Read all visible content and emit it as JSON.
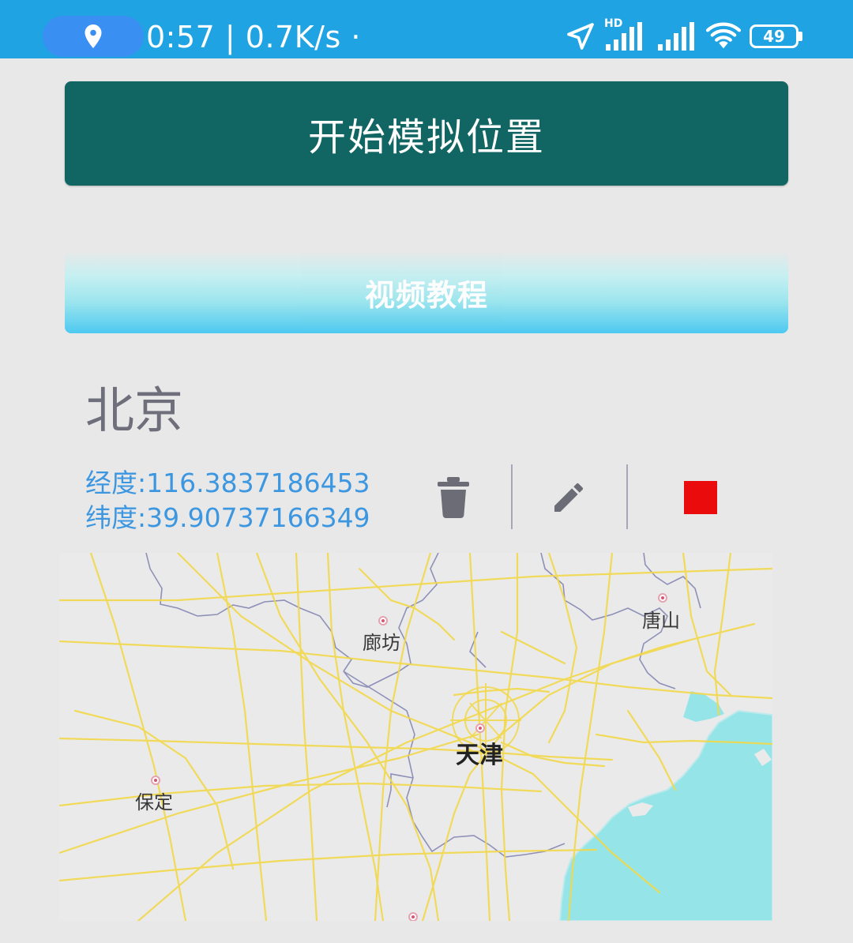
{
  "status_bar": {
    "time_speed": "0:57 | 0.7K/s ·",
    "battery_level": "49",
    "hd_label": "HD",
    "icons": [
      "location-pin-icon",
      "navigation-arrow-icon",
      "signal-icon",
      "signal-icon",
      "wifi-icon",
      "battery-icon"
    ],
    "background": "#1fa3e3"
  },
  "buttons": {
    "start_label": "开始模拟位置",
    "video_label": "视频教程"
  },
  "location": {
    "city": "北京",
    "longitude_label": "经度:",
    "longitude_value": "116.3837186453",
    "latitude_label": "纬度:",
    "latitude_value": "39.90737166349"
  },
  "actions": {
    "icons": [
      "trash-icon",
      "pencil-icon",
      "stop-icon"
    ],
    "stop_color": "#ea0c0c"
  },
  "map": {
    "labels": {
      "langfang": "廊坊",
      "tangshan": "唐山",
      "tianjin": "天津",
      "baoding": "保定"
    },
    "sea_color": "#95e5e8",
    "road_color": "#f2d84a"
  },
  "colors": {
    "primary_button": "#116664",
    "coordinate_text": "#3d97e0",
    "city_text": "#6e6f7b"
  }
}
